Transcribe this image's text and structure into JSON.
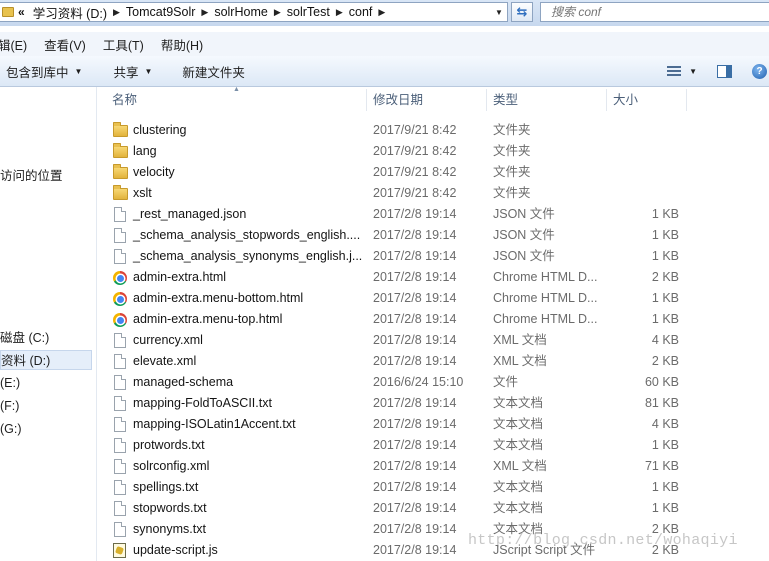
{
  "address": {
    "lead": "«",
    "crumbs": [
      "学习资料 (D:)",
      "Tomcat9Solr",
      "solrHome",
      "solrTest",
      "conf"
    ],
    "search_placeholder": "搜索 conf"
  },
  "menu": [
    "编辑(E)",
    "查看(V)",
    "工具(T)",
    "帮助(H)"
  ],
  "menu_display": [
    "辑(E)",
    "查看(V)",
    "工具(T)",
    "帮助(H)"
  ],
  "toolbar": {
    "include_library": "包含到库中",
    "share": "共享",
    "new_folder": "新建文件夹"
  },
  "nav": {
    "recent_places": "访问的位置",
    "drives": [
      "磁盘 (C:)",
      "资料 (D:)",
      "(E:)",
      "(F:)",
      "(G:)"
    ]
  },
  "columns": {
    "name": "名称",
    "date": "修改日期",
    "type": "类型",
    "size": "大小"
  },
  "files": [
    {
      "icon": "folder",
      "name": "clustering",
      "date": "2017/9/21 8:42",
      "type": "文件夹",
      "size": ""
    },
    {
      "icon": "folder",
      "name": "lang",
      "date": "2017/9/21 8:42",
      "type": "文件夹",
      "size": ""
    },
    {
      "icon": "folder",
      "name": "velocity",
      "date": "2017/9/21 8:42",
      "type": "文件夹",
      "size": ""
    },
    {
      "icon": "folder",
      "name": "xslt",
      "date": "2017/9/21 8:42",
      "type": "文件夹",
      "size": ""
    },
    {
      "icon": "doc",
      "name": "_rest_managed.json",
      "date": "2017/2/8 19:14",
      "type": "JSON 文件",
      "size": "1 KB"
    },
    {
      "icon": "doc",
      "name": "_schema_analysis_stopwords_english....",
      "date": "2017/2/8 19:14",
      "type": "JSON 文件",
      "size": "1 KB"
    },
    {
      "icon": "doc",
      "name": "_schema_analysis_synonyms_english.j...",
      "date": "2017/2/8 19:14",
      "type": "JSON 文件",
      "size": "1 KB"
    },
    {
      "icon": "chrome",
      "name": "admin-extra.html",
      "date": "2017/2/8 19:14",
      "type": "Chrome HTML D...",
      "size": "2 KB"
    },
    {
      "icon": "chrome",
      "name": "admin-extra.menu-bottom.html",
      "date": "2017/2/8 19:14",
      "type": "Chrome HTML D...",
      "size": "1 KB"
    },
    {
      "icon": "chrome",
      "name": "admin-extra.menu-top.html",
      "date": "2017/2/8 19:14",
      "type": "Chrome HTML D...",
      "size": "1 KB"
    },
    {
      "icon": "doc",
      "name": "currency.xml",
      "date": "2017/2/8 19:14",
      "type": "XML 文档",
      "size": "4 KB"
    },
    {
      "icon": "doc",
      "name": "elevate.xml",
      "date": "2017/2/8 19:14",
      "type": "XML 文档",
      "size": "2 KB"
    },
    {
      "icon": "doc",
      "name": "managed-schema",
      "date": "2016/6/24 15:10",
      "type": "文件",
      "size": "60 KB"
    },
    {
      "icon": "doc",
      "name": "mapping-FoldToASCII.txt",
      "date": "2017/2/8 19:14",
      "type": "文本文档",
      "size": "81 KB"
    },
    {
      "icon": "doc",
      "name": "mapping-ISOLatin1Accent.txt",
      "date": "2017/2/8 19:14",
      "type": "文本文档",
      "size": "4 KB"
    },
    {
      "icon": "doc",
      "name": "protwords.txt",
      "date": "2017/2/8 19:14",
      "type": "文本文档",
      "size": "1 KB"
    },
    {
      "icon": "doc",
      "name": "solrconfig.xml",
      "date": "2017/2/8 19:14",
      "type": "XML 文档",
      "size": "71 KB"
    },
    {
      "icon": "doc",
      "name": "spellings.txt",
      "date": "2017/2/8 19:14",
      "type": "文本文档",
      "size": "1 KB"
    },
    {
      "icon": "doc",
      "name": "stopwords.txt",
      "date": "2017/2/8 19:14",
      "type": "文本文档",
      "size": "1 KB"
    },
    {
      "icon": "doc",
      "name": "synonyms.txt",
      "date": "2017/2/8 19:14",
      "type": "文本文档",
      "size": "2 KB"
    },
    {
      "icon": "script",
      "name": "update-script.js",
      "date": "2017/2/8 19:14",
      "type": "JScript Script 文件",
      "size": "2 KB"
    }
  ],
  "watermark": "http://blog.csdn.net/wohaqiyi"
}
